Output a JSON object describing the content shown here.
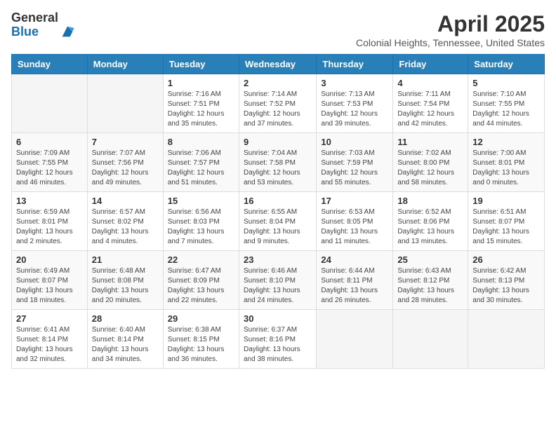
{
  "header": {
    "logo_general": "General",
    "logo_blue": "Blue",
    "month_title": "April 2025",
    "location": "Colonial Heights, Tennessee, United States"
  },
  "weekdays": [
    "Sunday",
    "Monday",
    "Tuesday",
    "Wednesday",
    "Thursday",
    "Friday",
    "Saturday"
  ],
  "weeks": [
    [
      {
        "day": "",
        "info": ""
      },
      {
        "day": "",
        "info": ""
      },
      {
        "day": "1",
        "info": "Sunrise: 7:16 AM\nSunset: 7:51 PM\nDaylight: 12 hours and 35 minutes."
      },
      {
        "day": "2",
        "info": "Sunrise: 7:14 AM\nSunset: 7:52 PM\nDaylight: 12 hours and 37 minutes."
      },
      {
        "day": "3",
        "info": "Sunrise: 7:13 AM\nSunset: 7:53 PM\nDaylight: 12 hours and 39 minutes."
      },
      {
        "day": "4",
        "info": "Sunrise: 7:11 AM\nSunset: 7:54 PM\nDaylight: 12 hours and 42 minutes."
      },
      {
        "day": "5",
        "info": "Sunrise: 7:10 AM\nSunset: 7:55 PM\nDaylight: 12 hours and 44 minutes."
      }
    ],
    [
      {
        "day": "6",
        "info": "Sunrise: 7:09 AM\nSunset: 7:55 PM\nDaylight: 12 hours and 46 minutes."
      },
      {
        "day": "7",
        "info": "Sunrise: 7:07 AM\nSunset: 7:56 PM\nDaylight: 12 hours and 49 minutes."
      },
      {
        "day": "8",
        "info": "Sunrise: 7:06 AM\nSunset: 7:57 PM\nDaylight: 12 hours and 51 minutes."
      },
      {
        "day": "9",
        "info": "Sunrise: 7:04 AM\nSunset: 7:58 PM\nDaylight: 12 hours and 53 minutes."
      },
      {
        "day": "10",
        "info": "Sunrise: 7:03 AM\nSunset: 7:59 PM\nDaylight: 12 hours and 55 minutes."
      },
      {
        "day": "11",
        "info": "Sunrise: 7:02 AM\nSunset: 8:00 PM\nDaylight: 12 hours and 58 minutes."
      },
      {
        "day": "12",
        "info": "Sunrise: 7:00 AM\nSunset: 8:01 PM\nDaylight: 13 hours and 0 minutes."
      }
    ],
    [
      {
        "day": "13",
        "info": "Sunrise: 6:59 AM\nSunset: 8:01 PM\nDaylight: 13 hours and 2 minutes."
      },
      {
        "day": "14",
        "info": "Sunrise: 6:57 AM\nSunset: 8:02 PM\nDaylight: 13 hours and 4 minutes."
      },
      {
        "day": "15",
        "info": "Sunrise: 6:56 AM\nSunset: 8:03 PM\nDaylight: 13 hours and 7 minutes."
      },
      {
        "day": "16",
        "info": "Sunrise: 6:55 AM\nSunset: 8:04 PM\nDaylight: 13 hours and 9 minutes."
      },
      {
        "day": "17",
        "info": "Sunrise: 6:53 AM\nSunset: 8:05 PM\nDaylight: 13 hours and 11 minutes."
      },
      {
        "day": "18",
        "info": "Sunrise: 6:52 AM\nSunset: 8:06 PM\nDaylight: 13 hours and 13 minutes."
      },
      {
        "day": "19",
        "info": "Sunrise: 6:51 AM\nSunset: 8:07 PM\nDaylight: 13 hours and 15 minutes."
      }
    ],
    [
      {
        "day": "20",
        "info": "Sunrise: 6:49 AM\nSunset: 8:07 PM\nDaylight: 13 hours and 18 minutes."
      },
      {
        "day": "21",
        "info": "Sunrise: 6:48 AM\nSunset: 8:08 PM\nDaylight: 13 hours and 20 minutes."
      },
      {
        "day": "22",
        "info": "Sunrise: 6:47 AM\nSunset: 8:09 PM\nDaylight: 13 hours and 22 minutes."
      },
      {
        "day": "23",
        "info": "Sunrise: 6:46 AM\nSunset: 8:10 PM\nDaylight: 13 hours and 24 minutes."
      },
      {
        "day": "24",
        "info": "Sunrise: 6:44 AM\nSunset: 8:11 PM\nDaylight: 13 hours and 26 minutes."
      },
      {
        "day": "25",
        "info": "Sunrise: 6:43 AM\nSunset: 8:12 PM\nDaylight: 13 hours and 28 minutes."
      },
      {
        "day": "26",
        "info": "Sunrise: 6:42 AM\nSunset: 8:13 PM\nDaylight: 13 hours and 30 minutes."
      }
    ],
    [
      {
        "day": "27",
        "info": "Sunrise: 6:41 AM\nSunset: 8:14 PM\nDaylight: 13 hours and 32 minutes."
      },
      {
        "day": "28",
        "info": "Sunrise: 6:40 AM\nSunset: 8:14 PM\nDaylight: 13 hours and 34 minutes."
      },
      {
        "day": "29",
        "info": "Sunrise: 6:38 AM\nSunset: 8:15 PM\nDaylight: 13 hours and 36 minutes."
      },
      {
        "day": "30",
        "info": "Sunrise: 6:37 AM\nSunset: 8:16 PM\nDaylight: 13 hours and 38 minutes."
      },
      {
        "day": "",
        "info": ""
      },
      {
        "day": "",
        "info": ""
      },
      {
        "day": "",
        "info": ""
      }
    ]
  ]
}
